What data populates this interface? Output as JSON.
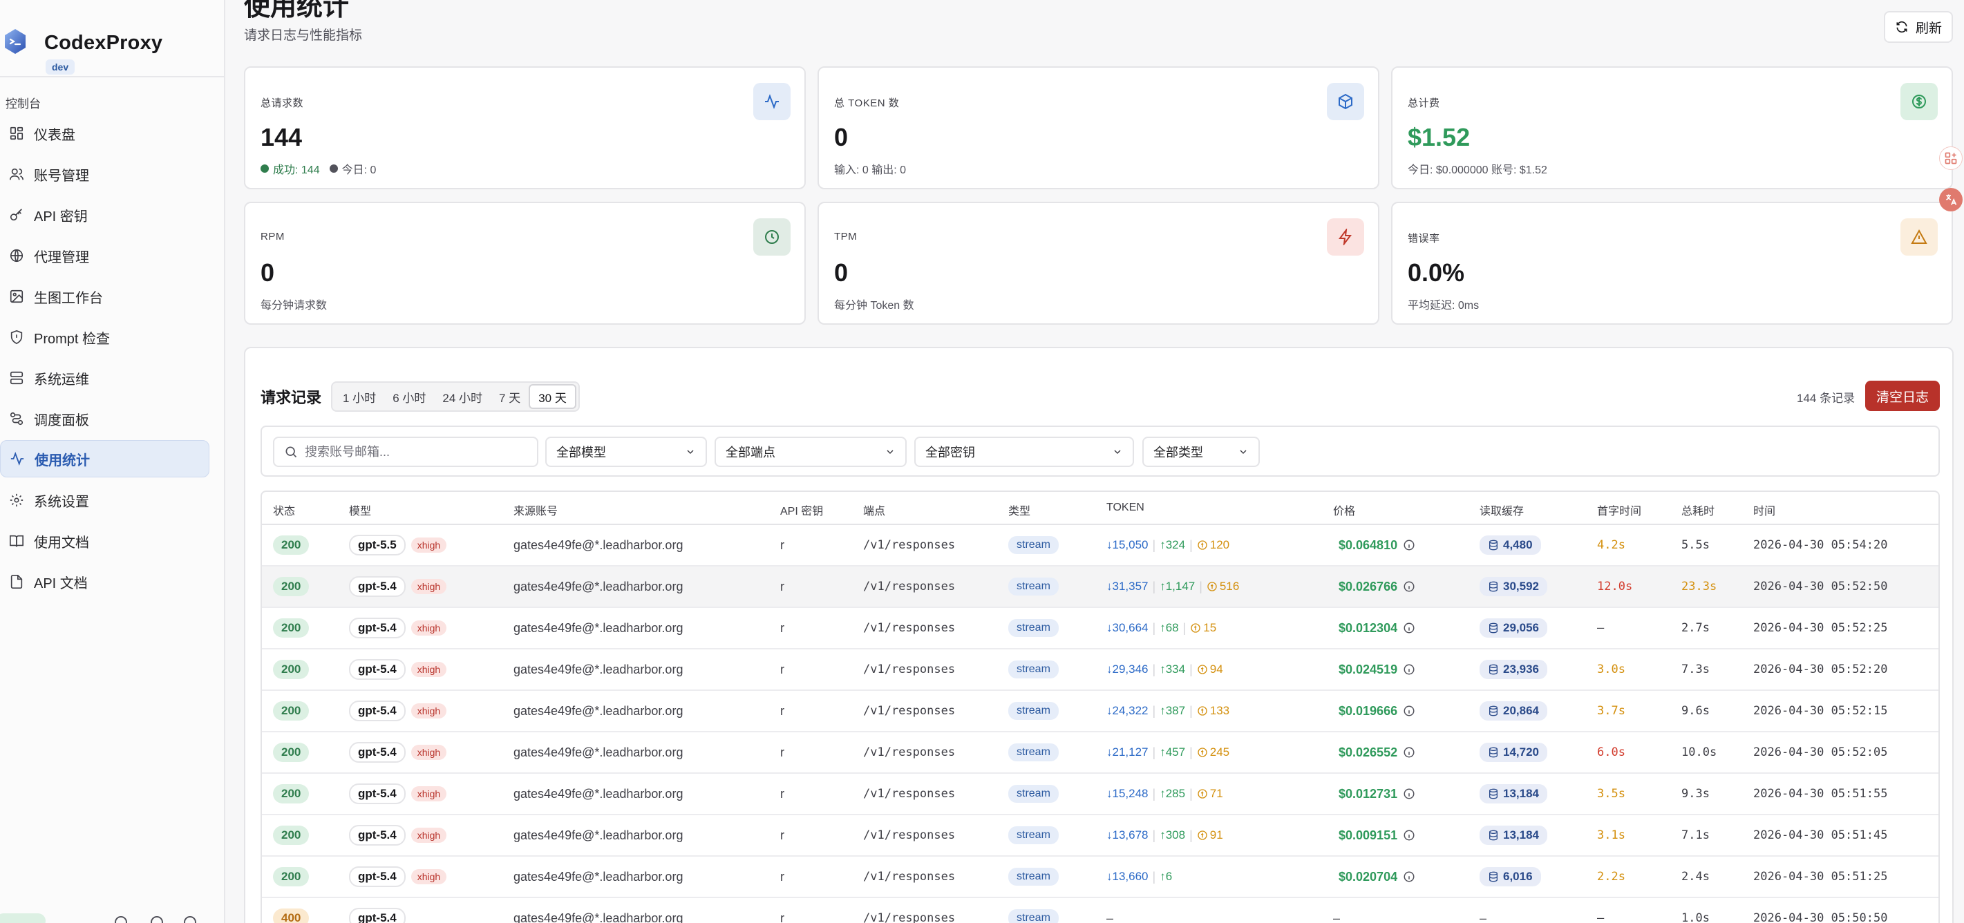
{
  "app": {
    "name": "CodexProxy",
    "badge": "dev"
  },
  "sidebar": {
    "section": "控制台",
    "items": [
      {
        "label": "仪表盘",
        "icon": "dashboard-icon"
      },
      {
        "label": "账号管理",
        "icon": "users-icon"
      },
      {
        "label": "API 密钥",
        "icon": "key-icon"
      },
      {
        "label": "代理管理",
        "icon": "globe-icon"
      },
      {
        "label": "生图工作台",
        "icon": "image-icon"
      },
      {
        "label": "Prompt 检查",
        "icon": "shield-icon"
      },
      {
        "label": "系统运维",
        "icon": "server-icon"
      },
      {
        "label": "调度面板",
        "icon": "route-icon"
      },
      {
        "label": "使用统计",
        "icon": "activity-icon",
        "active": true
      },
      {
        "label": "系统设置",
        "icon": "gear-icon"
      },
      {
        "label": "使用文档",
        "icon": "book-icon"
      },
      {
        "label": "API 文档",
        "icon": "file-icon"
      }
    ]
  },
  "header": {
    "title": "使用统计",
    "subtitle": "请求日志与性能指标",
    "refresh_label": "刷新"
  },
  "stats": [
    {
      "label": "总请求数",
      "value": "144",
      "sub_success": "成功: 144",
      "sub_today": "今日: 0",
      "icon": "activity-icon",
      "accent": "#2c6ac7"
    },
    {
      "label": "总 TOKEN 数",
      "value": "0",
      "sub": "输入: 0  输出: 0",
      "icon": "cube-icon",
      "accent": "#2c6ac7"
    },
    {
      "label": "总计费",
      "value": "$1.52",
      "sub": "今日: $0.000000  账号: $1.52",
      "icon": "dollar-icon",
      "accent": "#2f9a5b"
    },
    {
      "label": "RPM",
      "value": "0",
      "sub": "每分钟请求数",
      "icon": "clock-icon",
      "accent": "#2f7d4d"
    },
    {
      "label": "TPM",
      "value": "0",
      "sub": "每分钟 Token 数",
      "icon": "zap-icon",
      "accent": "#c0392b"
    },
    {
      "label": "错误率",
      "value": "0.0%",
      "sub": "平均延迟: 0ms",
      "icon": "alert-icon",
      "accent": "#c47a12"
    }
  ],
  "log": {
    "title": "请求记录",
    "ranges": [
      "1 小时",
      "6 小时",
      "24 小时",
      "7 天",
      "30 天"
    ],
    "active_range": "30 天",
    "count": "144 条记录",
    "clear_label": "清空日志",
    "search_placeholder": "搜索账号邮箱...",
    "filters": [
      "全部模型",
      "全部端点",
      "全部密钥",
      "全部类型"
    ],
    "columns": [
      "状态",
      "模型",
      "来源账号",
      "API 密钥",
      "端点",
      "类型",
      "TOKEN",
      "价格",
      "读取缓存",
      "首字时间",
      "总耗时",
      "时间"
    ],
    "rows": [
      {
        "status": "200",
        "model": "gpt-5.5",
        "effort": "xhigh",
        "account": "gates4e49fe@*.leadharbor.org",
        "key": "r",
        "endpoint": "/v1/responses",
        "type": "stream",
        "tok_in": "↓15,050",
        "tok_out": "↑324",
        "tok_cache": "120",
        "price": "$0.064810",
        "cache": "4,480",
        "ttft": "4.2s",
        "ttft_level": "ok",
        "total": "5.5s",
        "total_level": "normal",
        "time": "2026-04-30 05:54:20"
      },
      {
        "status": "200",
        "model": "gpt-5.4",
        "effort": "xhigh",
        "account": "gates4e49fe@*.leadharbor.org",
        "key": "r",
        "endpoint": "/v1/responses",
        "type": "stream",
        "tok_in": "↓31,357",
        "tok_out": "↑1,147",
        "tok_cache": "516",
        "price": "$0.026766",
        "cache": "30,592",
        "ttft": "12.0s",
        "ttft_level": "bad",
        "total": "23.3s",
        "total_level": "bad",
        "time": "2026-04-30 05:52:50"
      },
      {
        "status": "200",
        "model": "gpt-5.4",
        "effort": "xhigh",
        "account": "gates4e49fe@*.leadharbor.org",
        "key": "r",
        "endpoint": "/v1/responses",
        "type": "stream",
        "tok_in": "↓30,664",
        "tok_out": "↑68",
        "tok_cache": "15",
        "price": "$0.012304",
        "cache": "29,056",
        "ttft": "–",
        "ttft_level": "none",
        "total": "2.7s",
        "total_level": "normal",
        "time": "2026-04-30 05:52:25"
      },
      {
        "status": "200",
        "model": "gpt-5.4",
        "effort": "xhigh",
        "account": "gates4e49fe@*.leadharbor.org",
        "key": "r",
        "endpoint": "/v1/responses",
        "type": "stream",
        "tok_in": "↓29,346",
        "tok_out": "↑334",
        "tok_cache": "94",
        "price": "$0.024519",
        "cache": "23,936",
        "ttft": "3.0s",
        "ttft_level": "ok",
        "total": "7.3s",
        "total_level": "normal",
        "time": "2026-04-30 05:52:20"
      },
      {
        "status": "200",
        "model": "gpt-5.4",
        "effort": "xhigh",
        "account": "gates4e49fe@*.leadharbor.org",
        "key": "r",
        "endpoint": "/v1/responses",
        "type": "stream",
        "tok_in": "↓24,322",
        "tok_out": "↑387",
        "tok_cache": "133",
        "price": "$0.019666",
        "cache": "20,864",
        "ttft": "3.7s",
        "ttft_level": "ok",
        "total": "9.6s",
        "total_level": "normal",
        "time": "2026-04-30 05:52:15"
      },
      {
        "status": "200",
        "model": "gpt-5.4",
        "effort": "xhigh",
        "account": "gates4e49fe@*.leadharbor.org",
        "key": "r",
        "endpoint": "/v1/responses",
        "type": "stream",
        "tok_in": "↓21,127",
        "tok_out": "↑457",
        "tok_cache": "245",
        "price": "$0.026552",
        "cache": "14,720",
        "ttft": "6.0s",
        "ttft_level": "bad",
        "total": "10.0s",
        "total_level": "normal",
        "time": "2026-04-30 05:52:05"
      },
      {
        "status": "200",
        "model": "gpt-5.4",
        "effort": "xhigh",
        "account": "gates4e49fe@*.leadharbor.org",
        "key": "r",
        "endpoint": "/v1/responses",
        "type": "stream",
        "tok_in": "↓15,248",
        "tok_out": "↑285",
        "tok_cache": "71",
        "price": "$0.012731",
        "cache": "13,184",
        "ttft": "3.5s",
        "ttft_level": "ok",
        "total": "9.3s",
        "total_level": "normal",
        "time": "2026-04-30 05:51:55"
      },
      {
        "status": "200",
        "model": "gpt-5.4",
        "effort": "xhigh",
        "account": "gates4e49fe@*.leadharbor.org",
        "key": "r",
        "endpoint": "/v1/responses",
        "type": "stream",
        "tok_in": "↓13,678",
        "tok_out": "↑308",
        "tok_cache": "91",
        "price": "$0.009151",
        "cache": "13,184",
        "ttft": "3.1s",
        "ttft_level": "ok",
        "total": "7.1s",
        "total_level": "normal",
        "time": "2026-04-30 05:51:45"
      },
      {
        "status": "200",
        "model": "gpt-5.4",
        "effort": "xhigh",
        "account": "gates4e49fe@*.leadharbor.org",
        "key": "r",
        "endpoint": "/v1/responses",
        "type": "stream",
        "tok_in": "↓13,660",
        "tok_out": "↑6",
        "tok_cache": "",
        "price": "$0.020704",
        "cache": "6,016",
        "ttft": "2.2s",
        "ttft_level": "ok",
        "total": "2.4s",
        "total_level": "normal",
        "time": "2026-04-30 05:51:25"
      },
      {
        "status": "400",
        "model": "gpt-5.4",
        "effort": "",
        "account": "gates4e49fe@*.leadharbor.org",
        "key": "r",
        "endpoint": "/v1/responses",
        "type": "stream",
        "tok_in": "",
        "tok_out": "",
        "tok_cache": "",
        "token_dash": "–",
        "price": "",
        "price_dash": "–",
        "cache": "",
        "cache_dash": "–",
        "ttft": "–",
        "ttft_level": "none",
        "total": "1.0s",
        "total_level": "normal",
        "time": "2026-04-30 05:50:50"
      }
    ]
  }
}
